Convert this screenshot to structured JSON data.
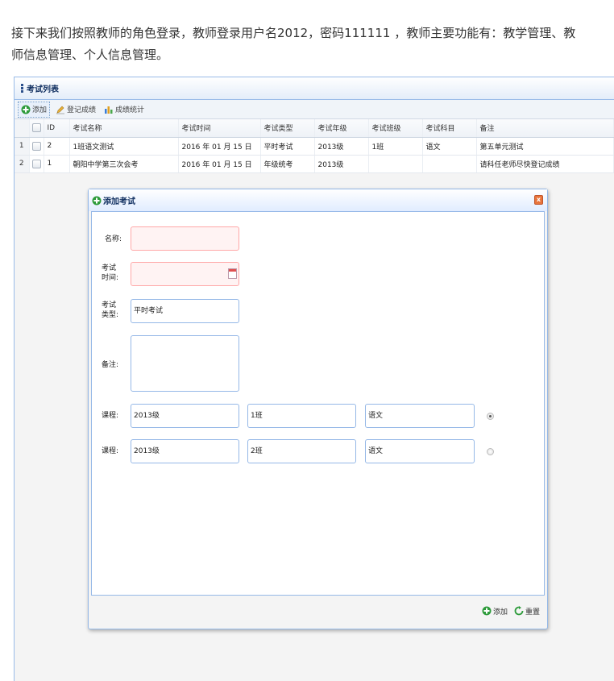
{
  "intro": {
    "line1": "接下来我们按照教师的角色登录，教师登录用户名2012，密码111111 ，教师主要功能有：教学管理、教",
    "line2": "师信息管理、个人信息管理。"
  },
  "panel": {
    "title": "考试列表"
  },
  "toolbar": {
    "add_label": "添加",
    "register_label": "登记成绩",
    "stats_label": "成绩统计"
  },
  "grid": {
    "columns": [
      "ID",
      "考试名称",
      "考试时间",
      "考试类型",
      "考试年级",
      "考试班级",
      "考试科目",
      "备注"
    ],
    "rows": [
      {
        "rownum": "1",
        "id": "2",
        "name": "1班语文测试",
        "time": "2016 年 01 月 15 日",
        "type": "平时考试",
        "grade": "2013级",
        "class": "1班",
        "subject": "语文",
        "note": "第五单元测试"
      },
      {
        "rownum": "2",
        "id": "1",
        "name": "朝阳中学第三次会考",
        "time": "2016 年 01 月 15 日",
        "type": "年级统考",
        "grade": "2013级",
        "class": "",
        "subject": "",
        "note": "请科任老师尽快登记成绩"
      }
    ]
  },
  "dialog": {
    "title": "添加考试",
    "name_label": "名称:",
    "time_label_1": "考试",
    "time_label_2": "时间:",
    "type_label_1": "考试",
    "type_label_2": "类型:",
    "type_value": "平时考试",
    "note_label": "备注:",
    "course_label": "课程:",
    "courses": [
      {
        "grade": "2013级",
        "class": "1班",
        "subject": "语文",
        "selected": true
      },
      {
        "grade": "2013级",
        "class": "2班",
        "subject": "语文",
        "selected": false
      }
    ],
    "add_label": "添加",
    "reset_label": "重置"
  },
  "colors": {
    "border": "#95b8e7",
    "header_text": "#0e2d5f",
    "add_icon": "#2e9b3b"
  },
  "icons": [
    "dots-icon",
    "add-icon",
    "edit-icon",
    "chart-icon",
    "close-icon",
    "calendar-icon",
    "reload-icon"
  ]
}
